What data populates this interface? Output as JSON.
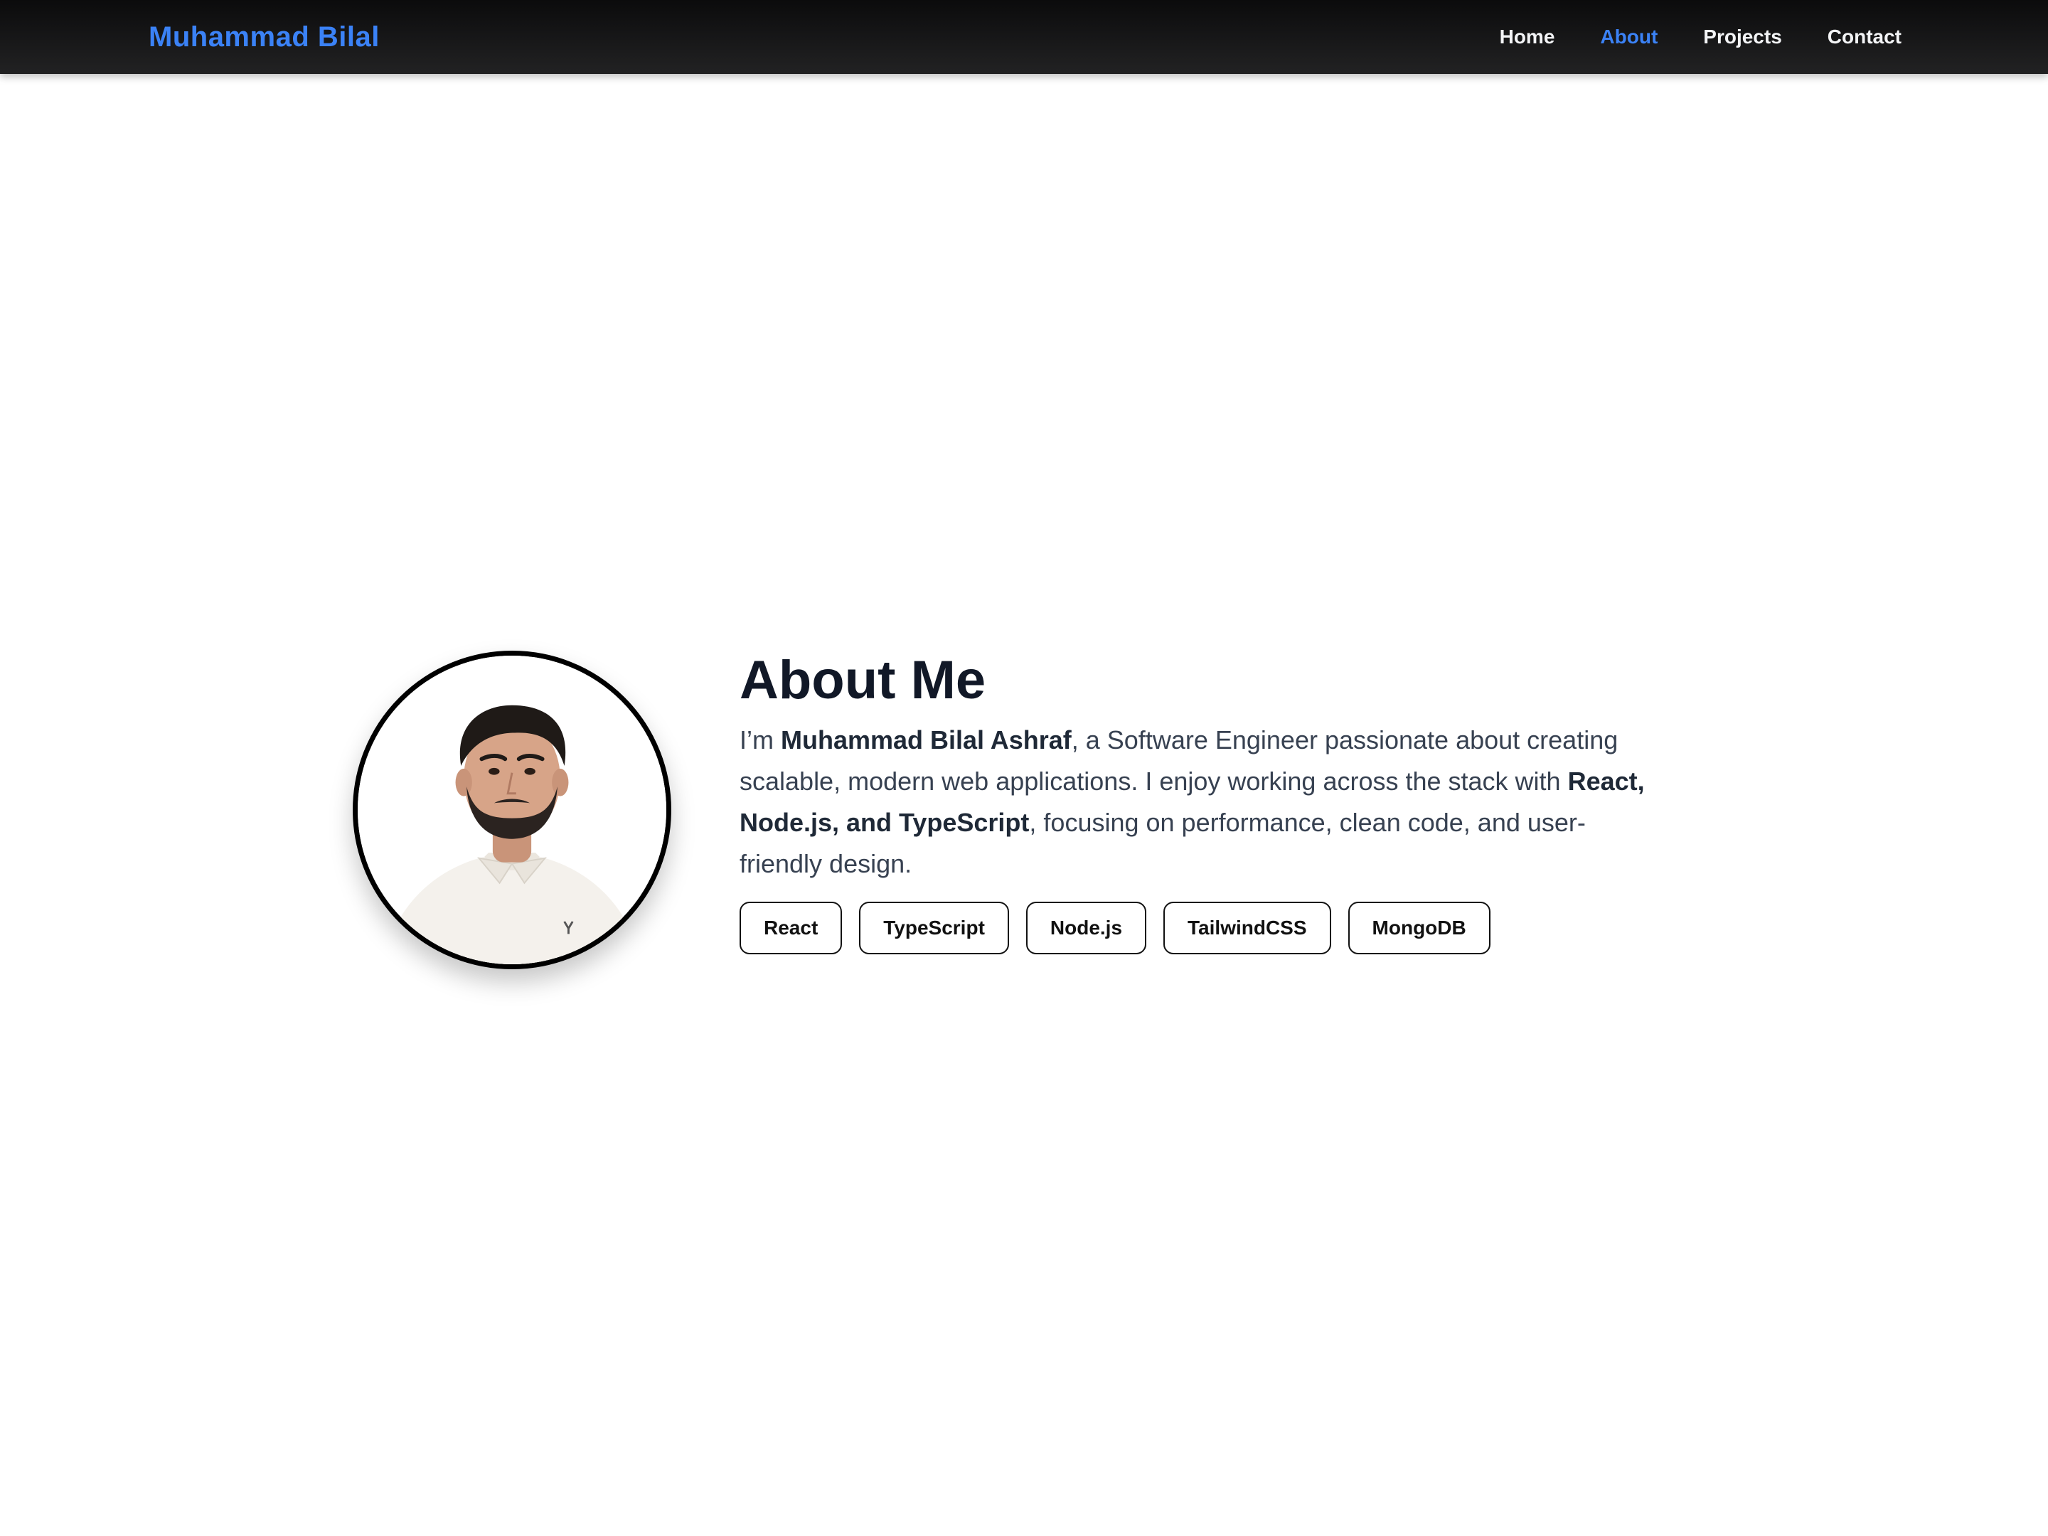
{
  "nav": {
    "brand": "Muhammad Bilal",
    "links": [
      {
        "label": "Home",
        "active": false
      },
      {
        "label": "About",
        "active": true
      },
      {
        "label": "Projects",
        "active": false
      },
      {
        "label": "Contact",
        "active": false
      }
    ]
  },
  "about": {
    "title": "About Me",
    "bio": {
      "p1": "I’m ",
      "name": "Muhammad Bilal Ashraf",
      "p2": ", a Software Engineer passionate about creating scalable, modern web applications. I enjoy working across the stack with ",
      "stack": "React, Node.js, and TypeScript",
      "p3": ", focusing on performance, clean code, and user-friendly design."
    },
    "skills": [
      "React",
      "TypeScript",
      "Node.js",
      "TailwindCSS",
      "MongoDB"
    ]
  },
  "colors": {
    "accent": "#3b82f6",
    "nav_bg": "#111111",
    "heading": "#111827",
    "body_text": "#374151"
  },
  "icons": {
    "avatar": "profile-photo"
  }
}
